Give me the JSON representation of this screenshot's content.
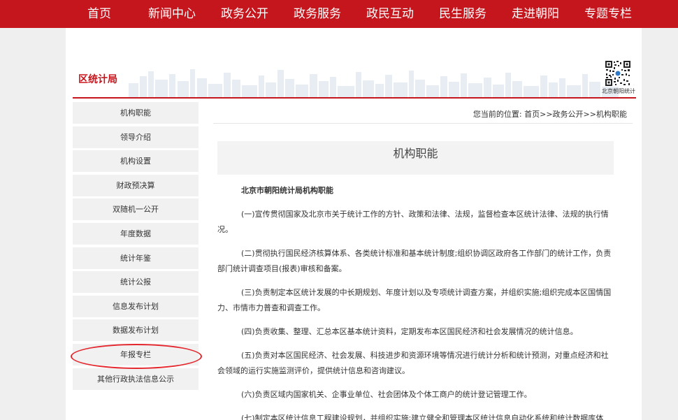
{
  "nav": [
    "首页",
    "新闻中心",
    "政务公开",
    "政务服务",
    "政民互动",
    "民生服务",
    "走进朝阳",
    "专题专栏"
  ],
  "banner": {
    "title": "区统计局",
    "qr_caption": "北京朝阳统计"
  },
  "sidebar": {
    "items": [
      "机构职能",
      "领导介绍",
      "机构设置",
      "财政预决算",
      "双随机一公开",
      "年度数据",
      "统计年鉴",
      "统计公报",
      "信息发布计划",
      "数据发布计划",
      "年报专栏",
      "其他行政执法信息公示"
    ],
    "highlighted": "年报专栏"
  },
  "breadcrumb": "您当前的位置: 首页>>政务公开>>机构职能",
  "content": {
    "heading": "机构职能",
    "subtitle": "北京市朝阳统计局机构职能",
    "paragraphs": [
      "(一)宣传贯彻国家及北京市关于统计工作的方针、政策和法律、法规，监督检查本区统计法律、法规的执行情况。",
      "(二)贯彻执行国民经济核算体系、各类统计标准和基本统计制度;组织协调区政府各工作部门的统计工作，负责部门统计调查项目(报表)审核和备案。",
      "(三)负责制定本区统计发展的中长期规划、年度计划以及专项统计调查方案，并组织实施;组织完成本区国情国力、市情市力普查和调查工作。",
      "(四)负责收集、整理、汇总本区基本统计资料，定期发布本区国民经济和社会发展情况的统计信息。",
      "(五)负责对本区国民经济、社会发展、科技进步和资源环境等情况进行统计分析和统计预测，对重点经济和社会领域的运行实施监测评价，提供统计信息和咨询建议。",
      "(六)负责区域内国家机关、企事业单位、社会团体及个体工商户的统计登记管理工作。",
      "(七)制定本区统计信息工程建设规划，并组织实施;建立健全和管理本区统计信息自动化系统和统计数据库体"
    ]
  },
  "colors": {
    "brand_red": "#c5161d",
    "annotation_red": "#e4262d"
  }
}
